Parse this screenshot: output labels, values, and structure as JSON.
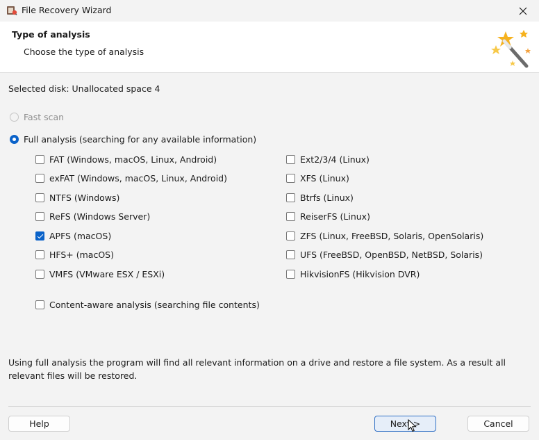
{
  "window": {
    "title": "File Recovery Wizard"
  },
  "header": {
    "title": "Type of analysis",
    "subtitle": "Choose the type of analysis"
  },
  "selected_disk": "Selected disk: Unallocated space 4",
  "scan_options": [
    {
      "label": "Fast scan",
      "checked": false,
      "disabled": true
    },
    {
      "label": "Full analysis (searching for any available information)",
      "checked": true,
      "disabled": false
    }
  ],
  "filesystems_left": [
    {
      "label": "FAT (Windows, macOS, Linux, Android)",
      "checked": false
    },
    {
      "label": "exFAT (Windows, macOS, Linux, Android)",
      "checked": false
    },
    {
      "label": "NTFS (Windows)",
      "checked": false
    },
    {
      "label": "ReFS (Windows Server)",
      "checked": false
    },
    {
      "label": "APFS (macOS)",
      "checked": true
    },
    {
      "label": "HFS+ (macOS)",
      "checked": false
    },
    {
      "label": "VMFS (VMware ESX / ESXi)",
      "checked": false
    }
  ],
  "filesystems_right": [
    {
      "label": "Ext2/3/4 (Linux)",
      "checked": false
    },
    {
      "label": "XFS (Linux)",
      "checked": false
    },
    {
      "label": "Btrfs (Linux)",
      "checked": false
    },
    {
      "label": "ReiserFS (Linux)",
      "checked": false
    },
    {
      "label": "ZFS (Linux, FreeBSD, Solaris, OpenSolaris)",
      "checked": false
    },
    {
      "label": "UFS (FreeBSD, OpenBSD, NetBSD, Solaris)",
      "checked": false
    },
    {
      "label": "HikvisionFS (Hikvision DVR)",
      "checked": false
    }
  ],
  "content_aware": {
    "label": "Content-aware analysis (searching file contents)",
    "checked": false
  },
  "description": "Using full analysis the program will find all relevant information on a drive and restore a file system. As a result all relevant files will be restored.",
  "buttons": {
    "help": "Help",
    "next": "Next >",
    "cancel": "Cancel"
  },
  "colors": {
    "accent": "#0a62c9",
    "header_bg": "#ffffff",
    "body_bg": "#f3f3f3"
  }
}
